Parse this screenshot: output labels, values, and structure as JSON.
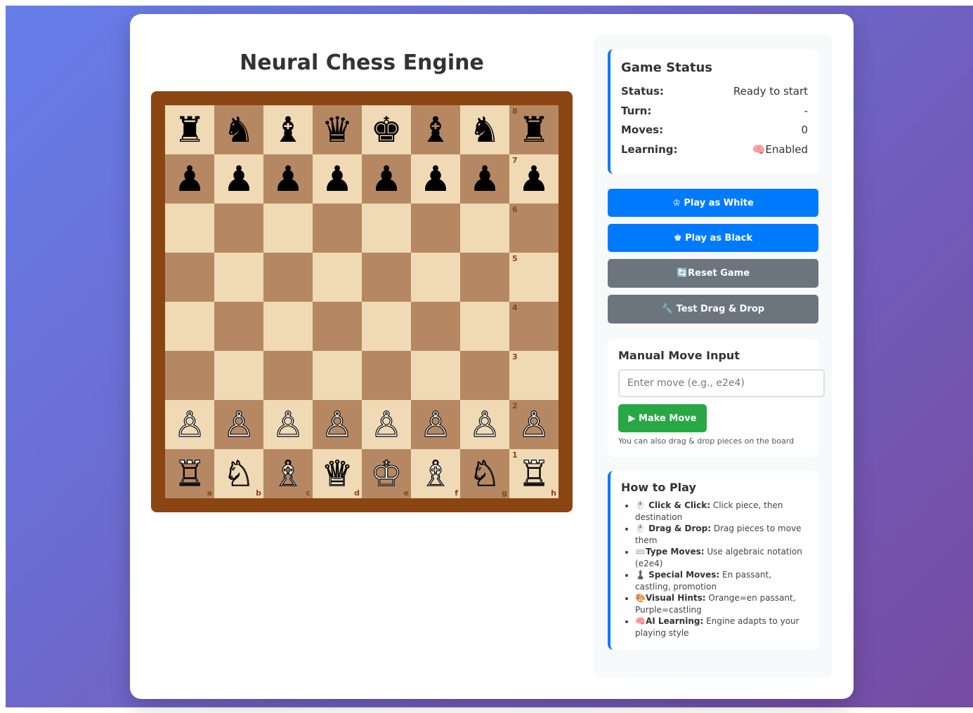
{
  "title": "Neural Chess Engine",
  "board": {
    "ranks": [
      [
        "♜",
        "♞",
        "♝",
        "♛",
        "♚",
        "♝",
        "♞",
        "♜"
      ],
      [
        "♟",
        "♟",
        "♟",
        "♟",
        "♟",
        "♟",
        "♟",
        "♟"
      ],
      [
        "",
        "",
        "",
        "",
        "",
        "",
        "",
        ""
      ],
      [
        "",
        "",
        "",
        "",
        "",
        "",
        "",
        ""
      ],
      [
        "",
        "",
        "",
        "",
        "",
        "",
        "",
        ""
      ],
      [
        "",
        "",
        "",
        "",
        "",
        "",
        "",
        ""
      ],
      [
        "♙",
        "♙",
        "♙",
        "♙",
        "♙",
        "♙",
        "♙",
        "♙"
      ],
      [
        "♖",
        "♘",
        "♗",
        "♕",
        "♔",
        "♗",
        "♘",
        "♖"
      ]
    ],
    "colors": [
      [
        "b",
        "b",
        "b",
        "b",
        "b",
        "b",
        "b",
        "b"
      ],
      [
        "b",
        "b",
        "b",
        "b",
        "b",
        "b",
        "b",
        "b"
      ],
      [
        "",
        "",
        "",
        "",
        "",
        "",
        "",
        ""
      ],
      [
        "",
        "",
        "",
        "",
        "",
        "",
        "",
        ""
      ],
      [
        "",
        "",
        "",
        "",
        "",
        "",
        "",
        ""
      ],
      [
        "",
        "",
        "",
        "",
        "",
        "",
        "",
        ""
      ],
      [
        "w",
        "w",
        "w",
        "w",
        "w",
        "w",
        "w",
        "w"
      ],
      [
        "w",
        "w",
        "w",
        "w",
        "w",
        "w",
        "w",
        "w"
      ]
    ],
    "rank_labels": [
      "8",
      "7",
      "6",
      "5",
      "4",
      "3",
      "2",
      "1"
    ],
    "file_labels": [
      "a",
      "b",
      "c",
      "d",
      "e",
      "f",
      "g",
      "h"
    ],
    "light_color": "#f0d9b5",
    "dark_color": "#b58863"
  },
  "status": {
    "title": "Game Status",
    "rows": [
      {
        "label": "Status:",
        "value": "Ready to start"
      },
      {
        "label": "Turn:",
        "value": "-"
      },
      {
        "label": "Moves:",
        "value": "0"
      },
      {
        "label": "Learning:",
        "value": "🧠Enabled"
      }
    ]
  },
  "buttons": {
    "play_white": "♔ Play as White",
    "play_black": "♚ Play as Black",
    "reset": "🔄Reset Game",
    "test_dnd": "🔧 Test Drag & Drop"
  },
  "manual": {
    "title": "Manual Move Input",
    "placeholder": "Enter move (e.g., e2e4)",
    "make_move": "▶ Make Move",
    "hint": "You can also drag & drop pieces on the board"
  },
  "howto": {
    "title": "How to Play",
    "items": [
      {
        "bold": "🖱️ Click & Click:",
        "text": " Click piece, then destination"
      },
      {
        "bold": "🖱️ Drag & Drop:",
        "text": " Drag pieces to move them"
      },
      {
        "bold": "⌨️Type Moves:",
        "text": " Use algebraic notation (e2e4)"
      },
      {
        "bold": "♟️ Special Moves:",
        "text": " En passant, castling, promotion"
      },
      {
        "bold": "🎨Visual Hints:",
        "text": " Orange=en passant, Purple=castling"
      },
      {
        "bold": "🧠AI Learning:",
        "text": " Engine adapts to your playing style"
      }
    ]
  },
  "colors": {
    "accent": "#007bff",
    "secondary": "#6c757d",
    "success": "#28a745",
    "board_frame": "#8b4513"
  }
}
